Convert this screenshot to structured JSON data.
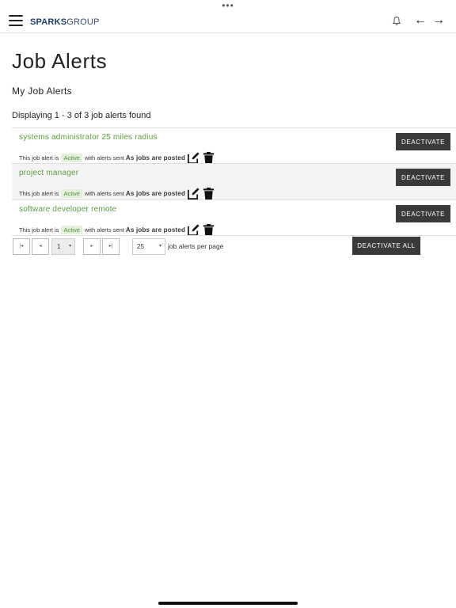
{
  "top_dots": "•••",
  "header": {
    "logo_bold": "SPARKS",
    "logo_light": "GROUP",
    "back_arrow": "←",
    "forward_arrow": "→"
  },
  "page": {
    "title": "Job Alerts",
    "subtitle": "My Job Alerts",
    "count_text": "Displaying 1 - 3 of 3 job alerts found"
  },
  "alerts": [
    {
      "title": "systems administrator 25 miles radius",
      "prefix": "This job alert is",
      "status": "Active",
      "middle": "with alerts sent",
      "frequency": "As jobs are posted",
      "button": "DEACTIVATE"
    },
    {
      "title": "project manager",
      "prefix": "This job alert is",
      "status": "Active",
      "middle": "with alerts sent",
      "frequency": "As jobs are posted",
      "button": "DEACTIVATE"
    },
    {
      "title": "software developer remote",
      "prefix": "This job alert is",
      "status": "Active",
      "middle": "with alerts sent",
      "frequency": "As jobs are posted",
      "button": "DEACTIVATE"
    }
  ],
  "pagination": {
    "first": "|◂",
    "prev": "◂",
    "page": "1",
    "next": "▸",
    "last": "▸|",
    "caret": "▾",
    "per_page": "25",
    "per_page_label": "job alerts per page"
  },
  "actions": {
    "deactivate_all": "DEACTIVATE ALL"
  },
  "icons": {
    "menu": "hamburger-icon",
    "bell": "bell-icon",
    "edit": "edit-icon",
    "delete": "trash-icon"
  },
  "colors": {
    "accent_green": "#5a9e3d",
    "badge_bg": "#e3f1dc",
    "button_dark": "#3a3a3a",
    "logo_blue": "#1b3e6b"
  }
}
